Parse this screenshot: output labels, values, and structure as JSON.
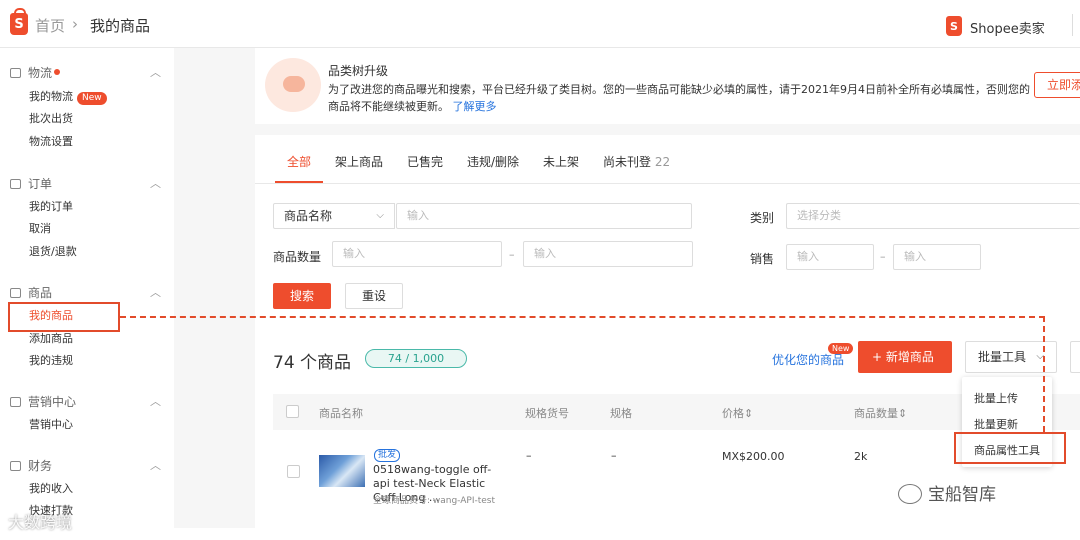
{
  "header": {
    "logo_glyph": "S",
    "crumb_home": "首页",
    "crumb_sep": "›",
    "crumb_current": "我的商品",
    "seller_logo_glyph": "S",
    "seller_name": "Shopee卖家"
  },
  "sidebar": {
    "logistics": {
      "title": "物流",
      "items": [
        "我的物流",
        "批次出货",
        "物流设置"
      ],
      "new_badge": "New"
    },
    "orders": {
      "title": "订单",
      "items": [
        "我的订单",
        "取消",
        "退货/退款"
      ]
    },
    "products": {
      "title": "商品",
      "items": [
        "我的商品",
        "添加商品",
        "我的违规"
      ]
    },
    "marketing": {
      "title": "营销中心",
      "items": [
        "营销中心"
      ]
    },
    "finance": {
      "title": "财务",
      "items": [
        "我的收入",
        "快速打款"
      ]
    },
    "chevron": "︿"
  },
  "notice": {
    "title": "品类树升级",
    "body": "为了改进您的商品曝光和搜索，平台已经升级了类目树。您的一些商品可能缺少必填的属性，请于2021年9月4日前补全所有必填属性，否则您的商品将不能继续被更新。",
    "link": "了解更多",
    "button": "立即添"
  },
  "tabs": [
    {
      "label": "全部"
    },
    {
      "label": "架上商品"
    },
    {
      "label": "已售完"
    },
    {
      "label": "违规/删除"
    },
    {
      "label": "未上架"
    },
    {
      "label": "尚未刊登",
      "count": "22"
    }
  ],
  "filters": {
    "name_select": "商品名称",
    "name_placeholder": "输入",
    "category_label": "类别",
    "category_placeholder": "选择分类",
    "quantity_label": "商品数量",
    "quantity_min_placeholder": "输入",
    "quantity_max_placeholder": "输入",
    "sales_label": "销售",
    "sales_min_placeholder": "输入",
    "sales_max_placeholder": "输入",
    "range_dash": "–",
    "search_button": "搜索",
    "reset_button": "重设"
  },
  "listing": {
    "count_title": "74 个商品",
    "quota": "74 / 1,000",
    "optimize_link": "优化您的商品",
    "optimize_badge": "New",
    "add_button": "+ 新增商品",
    "bulk_button": "批量工具",
    "bulk_menu": [
      "批量上传",
      "批量更新",
      "商品属性工具"
    ]
  },
  "table": {
    "columns": [
      "商品名称",
      "规格货号",
      "规格",
      "价格",
      "商品数量"
    ],
    "sort_glyph": "⇕",
    "rows": [
      {
        "tag": "批发",
        "name": "0518wang-toggle off-api test-Neck Elastic Cuff Long ...",
        "global_sku": "全球商品货号: wang-API-test",
        "variation_sku": "–",
        "variation": "–",
        "price": "MX$200.00",
        "stock": "2k"
      }
    ]
  },
  "watermarks": {
    "left": "大数跨境",
    "right": "宝船智库"
  },
  "colors": {
    "brand": "#ee4d2d",
    "link": "#2673dd",
    "quota": "#2aa38f",
    "highlight": "#e24b2b"
  }
}
